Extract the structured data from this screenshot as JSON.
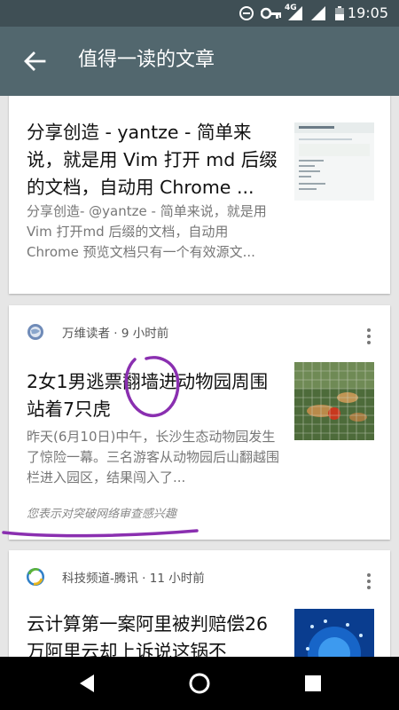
{
  "status_bar": {
    "time": "19:05",
    "icons": [
      "do-not-disturb-icon",
      "key-icon",
      "4g-signal-icon",
      "signal-icon",
      "battery-icon"
    ],
    "network_label": "4G"
  },
  "app_bar": {
    "title": "值得一读的文章",
    "back_icon": "arrow-back-icon",
    "background": "#52676e"
  },
  "articles": [
    {
      "title": "分享创造 - yantze - 简单来说，就是用 Vim 打开 md 后缀的文档，自动用 Chrome ...",
      "snippet": "分享创造- @yantze - 简单来说，就是用Vim 打开md 后缀的文档，自动用 Chrome 预览文档只有一个有效源文...",
      "thumbnail": "screenshot-thumbnail"
    },
    {
      "source": "万维读者 · 9 小时前",
      "title": "2女1男逃票翻墙进动物园周围站着7只虎",
      "snippet": "昨天(6月10日)中午，长沙生态动物园发生了惊险一幕。三名游客从动物园后山翻越围栏进入园区，结果闯入了...",
      "interest_note": "您表示对突破网络审查感兴趣",
      "thumbnail": "tigers-thumbnail",
      "annotation_color": "#8a2fb0"
    },
    {
      "source": "科技频道-腾讯 · 11 小时前",
      "title": "云计算第一案阿里被判赔偿26万阿里云却上诉说这锅不",
      "thumbnail": "cloud-tech-thumbnail"
    }
  ],
  "nav_bar": {
    "buttons": [
      "back-triangle-icon",
      "home-circle-icon",
      "recents-square-icon"
    ]
  }
}
